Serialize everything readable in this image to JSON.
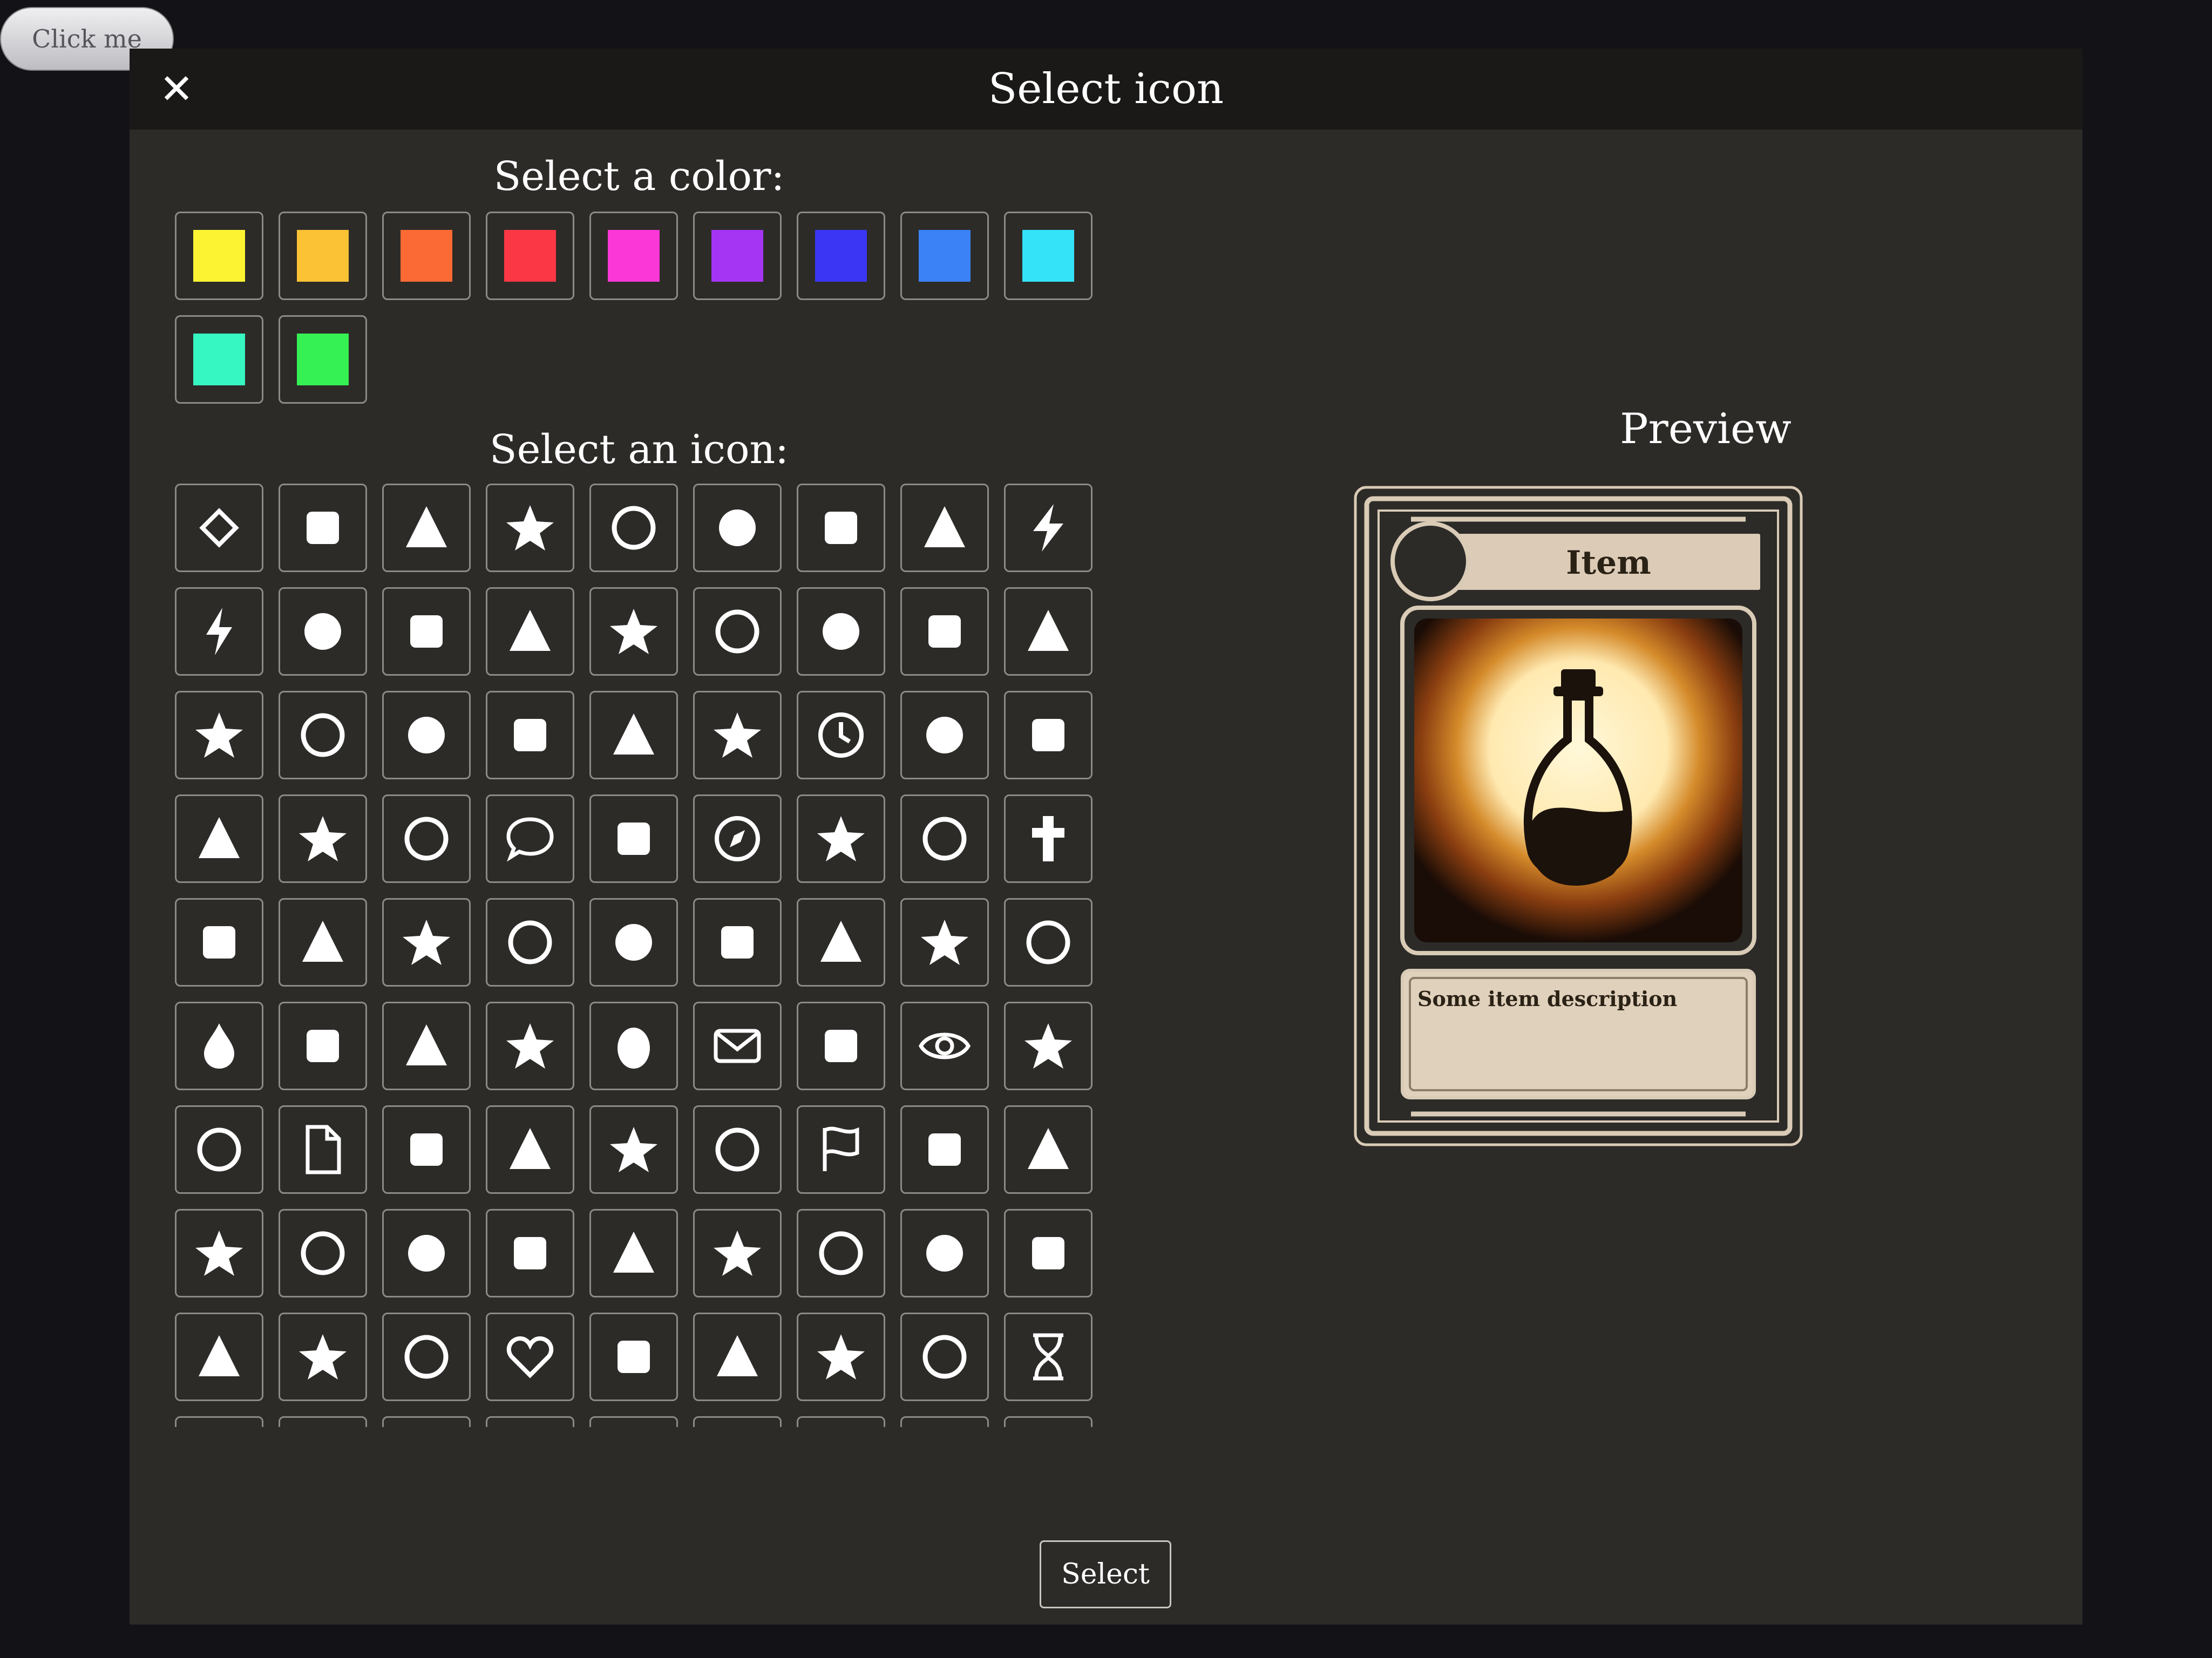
{
  "background": {
    "button_label": "Click me"
  },
  "modal": {
    "title": "Select icon",
    "close_glyph": "✕",
    "color_section_label": "Select a color:",
    "icon_section_label": "Select an icon:",
    "preview_label": "Preview",
    "select_label": "Select"
  },
  "colors": [
    "#fcf432",
    "#fcc235",
    "#fb6a34",
    "#fb3745",
    "#fb37d8",
    "#a534f3",
    "#3a36f3",
    "#3b82f6",
    "#35e3f9",
    "#36f7c1",
    "#35f153"
  ],
  "icons": [
    "diamond-icon",
    "anchor-icon",
    "pencil-icon",
    "briefcase-icon",
    "safe-icon",
    "money-bag-icon",
    "smiley-icon",
    "biohazard-icon",
    "lightning-icon",
    "lightning-bolt-icon",
    "bomb-icon",
    "bone-icon",
    "book-icon",
    "open-book-icon",
    "brush-icon",
    "explosion-icon",
    "tent-icon",
    "carrot-icon",
    "cat-icon",
    "chess-rook-icon",
    "chess-king-icon",
    "chess-queen-icon",
    "chess-knight-icon",
    "radiation-icon",
    "clock-icon",
    "storm-cloud-icon",
    "cloud-moon-icon",
    "cloud-rain-icon",
    "cloud-sun-icon",
    "clover-icon",
    "speech-bubble-icon",
    "chat-bubbles-icon",
    "compass-icon",
    "drafting-compass-icon",
    "cow-icon",
    "cross-icon",
    "crosshair-icon",
    "crow-icon",
    "crown-icon",
    "dice-icon",
    "d20-icon",
    "die-six-icon",
    "dog-icon",
    "dove-icon",
    "dragon-icon",
    "droplet-icon",
    "dinosaur-icon",
    "dungeon-gate-icon",
    "globe-icon",
    "egg-icon",
    "envelope-icon",
    "explosion-ground-icon",
    "eye-icon",
    "feather-icon",
    "quill-icon",
    "file-icon",
    "fingerprint-icon",
    "fire-icon",
    "flame-icon",
    "fish-icon",
    "flag-icon",
    "flask-icon",
    "frog-icon",
    "gear-icon",
    "gears-icon",
    "gem-icon",
    "ghost-icon",
    "gift-icon",
    "glasses-icon",
    "gun-icon",
    "hammer-icon",
    "hand-heart-icon",
    "hand-medical-icon",
    "hat-icon",
    "wizard-hat-icon",
    "heart-icon",
    "heart-bolt-icon",
    "helicopter-icon",
    "hippo-icon",
    "horse-icon",
    "hourglass-icon",
    "icon-91",
    "icon-92",
    "icon-93",
    "icon-94",
    "icon-95",
    "icon-96",
    "icon-97",
    "icon-98",
    "icon-99"
  ],
  "card": {
    "name": "Item",
    "description": "Some item description",
    "art_icon": "potion-bottle-icon"
  }
}
